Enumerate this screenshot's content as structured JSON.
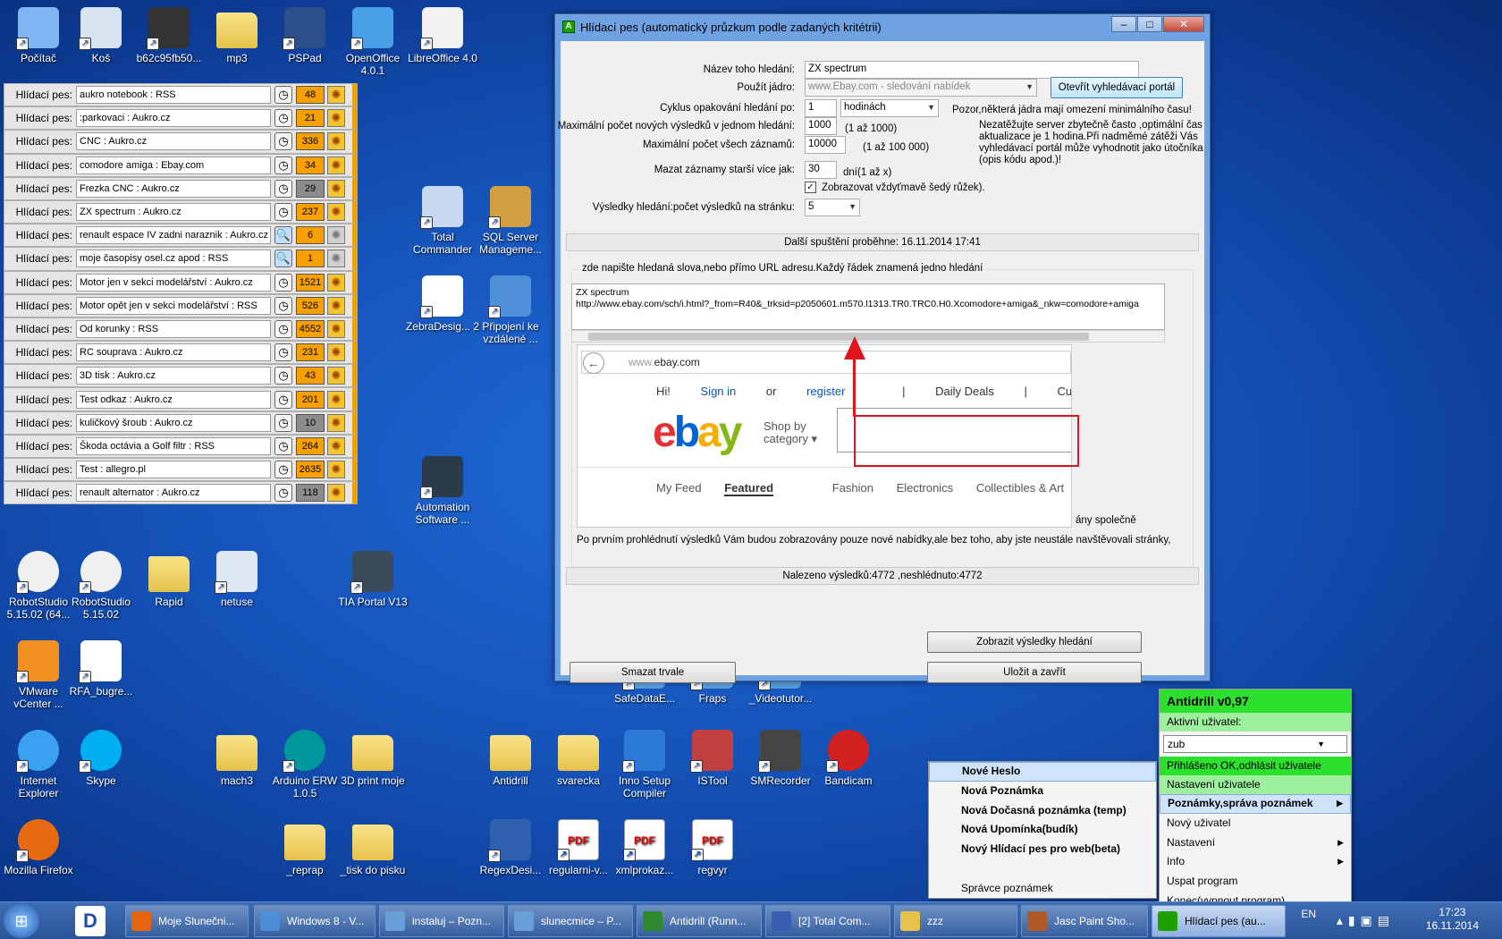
{
  "desktop_icons": [
    {
      "id": "pocitac",
      "label": "Počítač",
      "icon": "computer-icon"
    },
    {
      "id": "kos",
      "label": "Koš",
      "icon": "recycle-bin-icon"
    },
    {
      "id": "b62",
      "label": "b62c95fb50...",
      "icon": "image-file-icon"
    },
    {
      "id": "mp3",
      "label": "mp3",
      "icon": "folder-icon"
    },
    {
      "id": "pspad",
      "label": "PSPad",
      "icon": "pspad-icon"
    },
    {
      "id": "openoffice",
      "label": "OpenOffice 4.0.1",
      "icon": "openoffice-icon"
    },
    {
      "id": "libreoffice",
      "label": "LibreOffice 4.0",
      "icon": "libreoffice-icon"
    },
    {
      "id": "totalcmd",
      "label": "Total Commander",
      "icon": "total-commander-icon"
    },
    {
      "id": "sqlserver",
      "label": "SQL Server Manageme...",
      "icon": "sql-server-icon"
    },
    {
      "id": "zebra",
      "label": "ZebraDesig... 2",
      "icon": "zebra-designer-icon"
    },
    {
      "id": "pripojeni",
      "label": "Připojení ke vzdálené ...",
      "icon": "remote-desktop-icon"
    },
    {
      "id": "automation",
      "label": "Automation Software ...",
      "icon": "tia-automation-icon"
    },
    {
      "id": "robot1",
      "label": "RobotStudio 5.15.02 (64...",
      "icon": "robotstudio-icon"
    },
    {
      "id": "robot2",
      "label": "RobotStudio 5.15.02",
      "icon": "robotstudio-icon"
    },
    {
      "id": "rapid",
      "label": "Rapid",
      "icon": "folder-icon"
    },
    {
      "id": "netuse",
      "label": "netuse",
      "icon": "gear-file-icon"
    },
    {
      "id": "tiaportal",
      "label": "TIA Portal V13",
      "icon": "tia-portal-icon"
    },
    {
      "id": "vmware",
      "label": "VMware vCenter ...",
      "icon": "vmware-icon"
    },
    {
      "id": "rfa",
      "label": "RFA_bugre...",
      "icon": "text-file-icon"
    },
    {
      "id": "safedata",
      "label": "SafeDataE...",
      "icon": "app-icon"
    },
    {
      "id": "fraps",
      "label": "Fraps",
      "icon": "app-icon"
    },
    {
      "id": "videotutor",
      "label": "_Videotutor...",
      "icon": "app-icon"
    },
    {
      "id": "ie",
      "label": "Internet Explorer",
      "icon": "internet-explorer-icon"
    },
    {
      "id": "skype",
      "label": "Skype",
      "icon": "skype-icon"
    },
    {
      "id": "mach3",
      "label": "mach3",
      "icon": "folder-icon"
    },
    {
      "id": "arduino",
      "label": "Arduino ERW 1.0.5",
      "icon": "arduino-icon"
    },
    {
      "id": "print3d",
      "label": "3D print moje",
      "icon": "folder-icon"
    },
    {
      "id": "antidrill",
      "label": "Antidrill",
      "icon": "folder-icon"
    },
    {
      "id": "svarecka",
      "label": "svarecka",
      "icon": "folder-icon"
    },
    {
      "id": "innosetup",
      "label": "Inno Setup Compiler",
      "icon": "inno-setup-icon"
    },
    {
      "id": "istool",
      "label": "ISTool",
      "icon": "istool-icon"
    },
    {
      "id": "smrecorder",
      "label": "SMRecorder",
      "icon": "smrecorder-icon"
    },
    {
      "id": "bandicam",
      "label": "Bandicam",
      "icon": "bandicam-icon"
    },
    {
      "id": "firefox",
      "label": "Mozilla Firefox",
      "icon": "firefox-icon"
    },
    {
      "id": "reprap",
      "label": "_reprap",
      "icon": "folder-icon"
    },
    {
      "id": "tisk",
      "label": "_tisk do pisku",
      "icon": "folder-icon"
    },
    {
      "id": "regexdesi",
      "label": "RegexDesi...",
      "icon": "regex-designer-icon"
    },
    {
      "id": "regularni",
      "label": "regularni-v...",
      "icon": "pdf-icon"
    },
    {
      "id": "xmlprokaz",
      "label": "xmlprokaz...",
      "icon": "pdf-icon"
    },
    {
      "id": "regvyr",
      "label": "regvyr",
      "icon": "pdf-icon"
    }
  ],
  "watchdog_prefix": "Hlídací pes:",
  "watchdogs": [
    {
      "text": "aukro notebook  : RSS",
      "count": "48",
      "state": "orange"
    },
    {
      "text": ":parkovaci  : Aukro.cz",
      "count": "21",
      "state": "orange"
    },
    {
      "text": "CNC : Aukro.cz",
      "count": "336",
      "state": "orange"
    },
    {
      "text": "comodore amiga : Ebay.com",
      "count": "34",
      "state": "orange"
    },
    {
      "text": "Frezka CNC : Aukro.cz",
      "count": "29",
      "state": "grey"
    },
    {
      "text": "ZX spectrum : Aukro.cz",
      "count": "237",
      "state": "orange"
    },
    {
      "text": "renault espace IV zadni naraznik : Aukro.cz",
      "count": "6",
      "state": "orange",
      "search": true,
      "dim": true
    },
    {
      "text": "moje časopisy osel.cz apod : RSS",
      "count": "1",
      "state": "orange",
      "search": true,
      "dim": true
    },
    {
      "text": "Motor jen v sekci modelářství : Aukro.cz",
      "count": "1521",
      "state": "orange"
    },
    {
      "text": "Motor opět jen v sekci modelářství : RSS",
      "count": "526",
      "state": "orange"
    },
    {
      "text": "Od korunky : RSS",
      "count": "4552",
      "state": "orange"
    },
    {
      "text": "RC souprava : Aukro.cz",
      "count": "231",
      "state": "orange"
    },
    {
      "text": "3D tisk : Aukro.cz",
      "count": "43",
      "state": "orange"
    },
    {
      "text": "Test odkaz : Aukro.cz",
      "count": "201",
      "state": "orange"
    },
    {
      "text": "kuličkový šroub : Aukro.cz",
      "count": "10",
      "state": "grey"
    },
    {
      "text": "Škoda octávia a Golf filtr : RSS",
      "count": "264",
      "state": "orange"
    },
    {
      "text": "Test : allegro.pl",
      "count": "2635",
      "state": "orange"
    },
    {
      "text": "renault alternator : Aukro.cz",
      "count": "118",
      "state": "grey"
    }
  ],
  "window": {
    "title": "Hlídací pes (automatický průzkum podle zadaných kritétrii)",
    "name_label": "Název toho hledání:",
    "name_value": "ZX spectrum",
    "core_label": "Použít jádro:",
    "core_value": "www.Ebay.com - sledování nabídek",
    "open_portal": "Otevřít vyhledávací portál",
    "cycle_label": "Cyklus opakování hledání po:",
    "cycle_value": "1",
    "cycle_unit": "hodinách",
    "cycle_note": "Pozor,některá jádra mají omezení  minimálního času!",
    "maxnew_label": "Maximální počet nových výsledků v jednom hledání:",
    "maxnew_value": "1000",
    "maxnew_range": "(1 až 1000)",
    "maxall_label": "Maximální počet všech záznamů:",
    "maxall_value": "10000",
    "maxall_range": "(1 až 100 000)",
    "warning": [
      "Nezatěžujte server zbytečně často ,optimální čas",
      "aktualizace je 1 hodina.Při nadměmé zátěži Vás",
      "vyhledávací portál může vyhodnotit jako útočníka",
      "(opis kódu apod.)!"
    ],
    "delete_label": "Mazat záznamy starší více jak:",
    "delete_value": "30",
    "delete_unit": "dní(1 až x)",
    "checkbox_label": "Zobrazovat vždyťmavě šedý růžek).",
    "perpage_label": "Výsledky hledání:počet výsledků na stránku:",
    "perpage_value": "5",
    "next_run": "Další spuštění proběhne: 16.11.2014 17:41",
    "group_title": "zde napište hledaná slova,nebo přímo URL adresu.Každý řádek znamená jedno hledání",
    "textarea_line1": "ZX spectrum",
    "textarea_line2": "http://www.ebay.com/sch/i.html?_from=R40&_trksid=p2050601.m570.l1313.TR0.TRC0.H0.Xcomodore+amiga&_nkw=comodore+amiga",
    "partial_text": "ány společně",
    "info_text": "Po prvním prohlédnutí výsledků Vám budou zobrazovány pouze nové nabídky,ale bez toho, aby jste neustále navštěvovali stránky,",
    "found_text": "Nalezeno výsledků:4772 ,neshlédnuto:4772",
    "show_results": "Zobrazit výsledky hledání",
    "delete_btn": "Smazat trvale",
    "save_btn": "Uložit a zavřít"
  },
  "ebay": {
    "url_gray": "www.",
    "url_host": "ebay.com",
    "greeting": "Hi!",
    "sign_in": "Sign in",
    "or": "or",
    "register": "register",
    "daily_deals": "Daily Deals",
    "customer_support": "Customer Support",
    "shop_by": "Shop by",
    "category": "category",
    "tabs": [
      "My Feed",
      "Featured",
      "Fashion",
      "Electronics",
      "Collectibles & Art"
    ]
  },
  "menu_notes": [
    "Nové Heslo",
    "Nová Poznámka",
    "Nová Dočasná poznámka (temp)",
    "Nová Upomínka(budík)",
    "Nový Hlídací pes pro web(beta)",
    "",
    "Správce poznámek"
  ],
  "antidrill": {
    "title": "Antidrill v0,97",
    "active_user": "Aktivní uživatel:",
    "user": "zub",
    "items": [
      {
        "label": "Přihlášeno OK,odhlásit uživatele",
        "style": "green2"
      },
      {
        "label": "Nastavení uživatele",
        "style": "green"
      },
      {
        "label": "Poznámky,správa poznámek",
        "style": "hl",
        "sub": true
      },
      {
        "label": "Nový uživatel",
        "style": ""
      },
      {
        "label": "Nastavení",
        "style": "",
        "sub": true
      },
      {
        "label": "Info",
        "style": "",
        "sub": true
      },
      {
        "label": "Uspat program",
        "style": ""
      },
      {
        "label": "Konec(vypnout program)",
        "style": ""
      }
    ]
  },
  "taskbar": [
    {
      "label": "Moje Slunečni...",
      "icon": "firefox-icon",
      "color": "#e8650f"
    },
    {
      "label": "Windows 8 - V...",
      "icon": "vmware-icon",
      "color": "#4d8fd6"
    },
    {
      "label": "instaluj – Pozn...",
      "icon": "notepad-icon",
      "color": "#6aa0d8"
    },
    {
      "label": "slunecmice – P...",
      "icon": "notepad-icon",
      "color": "#6aa0d8"
    },
    {
      "label": "Antidrill (Runn...",
      "icon": "csharp-icon",
      "color": "#2f8a2f"
    },
    {
      "label": "[2] Total Com...",
      "icon": "total-commander-icon",
      "color": "#3a5fb0"
    },
    {
      "label": "zzz",
      "icon": "folder-icon",
      "color": "#e6c24a"
    },
    {
      "label": "Jasc Paint Sho...",
      "icon": "paintshop-icon",
      "color": "#b05a2a"
    },
    {
      "label": "Hlídací pes (au...",
      "icon": "antidrill-icon",
      "color": "#1da000",
      "active": true
    }
  ],
  "tray": {
    "lang": "EN",
    "time": "17:23",
    "date": "16.11.2014"
  }
}
